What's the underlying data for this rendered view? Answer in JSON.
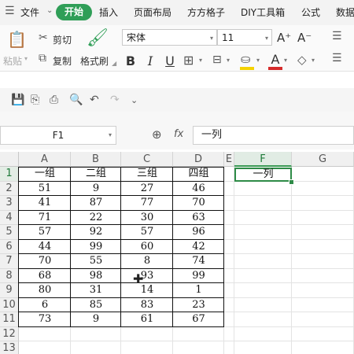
{
  "menubar": {
    "file": "文件",
    "tabs": [
      "开始",
      "插入",
      "页面布局",
      "方方格子",
      "DIY工具箱",
      "公式",
      "数据"
    ],
    "active_tab": "开始"
  },
  "ribbon": {
    "paste": "粘贴",
    "cut": "剪切",
    "copy": "复制",
    "format_painter": "格式刷",
    "font_name": "宋体",
    "font_size": "11",
    "grow_font": "A⁺",
    "shrink_font": "A⁻",
    "bold": "B",
    "italic": "I",
    "underline": "U",
    "font_color_letter": "A"
  },
  "accent_colors": {
    "brand_green": "#2f9e57",
    "font_color_red": "#d62b2b",
    "highlight_yellow": "#f5d200"
  },
  "formula_bar": {
    "name_box": "F1",
    "fx_label": "fx",
    "content": "一列"
  },
  "columns": [
    "A",
    "B",
    "C",
    "D",
    "E",
    "F",
    "G"
  ],
  "selected_column": "F",
  "rows": [
    "1",
    "2",
    "3",
    "4",
    "5",
    "6",
    "7",
    "8",
    "9",
    "10",
    "11",
    "12",
    "13"
  ],
  "selected_row": "1",
  "table": {
    "headers": [
      "一组",
      "二组",
      "三组",
      "四组"
    ],
    "data": [
      [
        "51",
        "9",
        "27",
        "46"
      ],
      [
        "41",
        "87",
        "77",
        "70"
      ],
      [
        "71",
        "22",
        "30",
        "63"
      ],
      [
        "57",
        "92",
        "57",
        "96"
      ],
      [
        "44",
        "99",
        "60",
        "42"
      ],
      [
        "70",
        "55",
        "8",
        "74"
      ],
      [
        "68",
        "98",
        "93",
        "99"
      ],
      [
        "80",
        "31",
        "14",
        "1"
      ],
      [
        "6",
        "85",
        "83",
        "23"
      ],
      [
        "73",
        "9",
        "61",
        "67"
      ]
    ]
  },
  "active_cell_value": "一列"
}
